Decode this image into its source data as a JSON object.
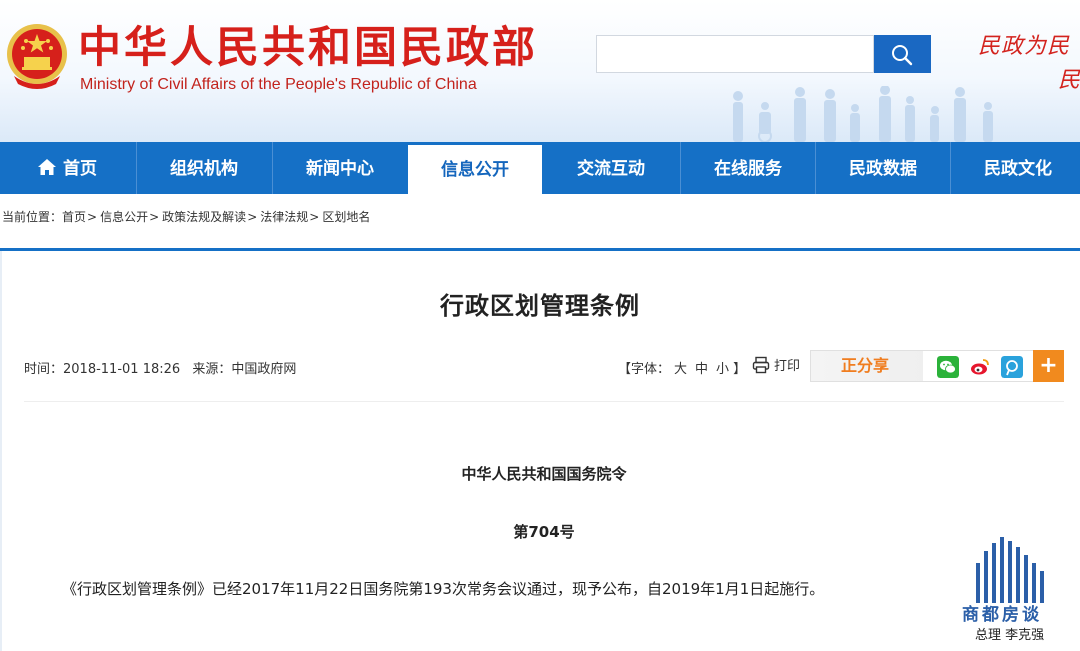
{
  "header": {
    "site_title_cn": "中华人民共和国民政部",
    "site_title_en": "Ministry of Civil Affairs of the People's Republic of China",
    "search": {
      "value": "",
      "placeholder": ""
    },
    "slogan": "民政为民",
    "slogan_line2": "民"
  },
  "nav": {
    "items": [
      {
        "label": "首页"
      },
      {
        "label": "组织机构"
      },
      {
        "label": "新闻中心"
      },
      {
        "label": "信息公开"
      },
      {
        "label": "交流互动"
      },
      {
        "label": "在线服务"
      },
      {
        "label": "民政数据"
      },
      {
        "label": "民政文化"
      }
    ],
    "active_index": 3
  },
  "breadcrumb": {
    "prefix": "当前位置：",
    "items": [
      "首页",
      "信息公开",
      "政策法规及解读",
      "法律法规",
      "区划地名"
    ],
    "separator": ">"
  },
  "article": {
    "title": "行政区划管理条例",
    "meta_time_label": "时间：",
    "meta_time": "2018-11-01 18:26",
    "meta_source_label": "来源：",
    "meta_source": "中国政府网",
    "fontsize_open": "【字体：",
    "fontsize_large": "大",
    "fontsize_medium": "中",
    "fontsize_small": "小",
    "fontsize_close": "】",
    "print_label": "打印",
    "share_label": "正分享",
    "share_more": "+",
    "order_title": "中华人民共和国国务院令",
    "order_number": "第704号",
    "body": "《行政区划管理条例》已经2017年11月22日国务院第193次常务会议通过，现予公布，自2019年1月1日起施行。"
  },
  "watermark": {
    "name": "商都房谈",
    "subtitle": "总理  李克强"
  },
  "colors": {
    "brand_red": "#d6201b",
    "nav_blue": "#1570c6",
    "share_orange": "#f07d1f"
  },
  "icons": {
    "search": "search-icon",
    "home": "home-icon",
    "print": "printer-icon",
    "wechat": "wechat-icon",
    "weibo": "weibo-icon",
    "tencent": "tencent-weibo-icon",
    "more": "plus-icon"
  }
}
